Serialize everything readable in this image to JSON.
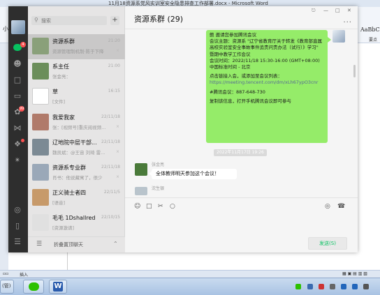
{
  "word": {
    "title": "11月18资源系党风实训室安全隐患排查工作部署.docx - Microsoft Word",
    "styles_preview": "AaBbCc",
    "styles_caption": "要点",
    "ribbon_fragment": "小",
    "status_insert": "插入",
    "taskbar_label": "(管)"
  },
  "wechat": {
    "sidebar": {
      "badges": {
        "chats": "4",
        "moments": "99"
      }
    },
    "search": {
      "placeholder": "搜索"
    },
    "add_label": "+",
    "conversations": [
      {
        "name": "资源系群",
        "time": "21:20",
        "preview": "资源管理制机制·陈于下降",
        "selected": true,
        "muted": true,
        "avatar_color": "#8aa07a"
      },
      {
        "name": "系主任",
        "time": "21:00",
        "preview": "张金亮：",
        "selected": false,
        "muted": false,
        "avatar_color": "#6b8e5a"
      },
      {
        "name": "草",
        "time": "16:15",
        "preview": "[文件]",
        "selected": false,
        "muted": false,
        "avatar_color": "#ffffff"
      },
      {
        "name": "我爱我家",
        "time": "22/11/18",
        "preview": "张：[视频号]重庆阅视频...",
        "selected": false,
        "muted": true,
        "avatar_color": "#b07a6a"
      },
      {
        "name": "辽地院中层干部...",
        "time": "22/11/18",
        "preview": "魏凯斌：@王宙 刘琦 雷...",
        "selected": false,
        "muted": true,
        "avatar_color": "#7c8a94"
      },
      {
        "name": "资源系专业群",
        "time": "22/11/18",
        "preview": "肖书：他说藏寓了，很少",
        "selected": false,
        "muted": true,
        "avatar_color": "#9aa8b8"
      },
      {
        "name": "正义骑士者四",
        "time": "22/11/5",
        "preview": "[语音]",
        "selected": false,
        "muted": false,
        "avatar_color": "#c79a6a"
      },
      {
        "name": "毛毛 1Dshallred",
        "time": "22/10/15",
        "preview": "[资源激请]",
        "selected": false,
        "muted": false,
        "avatar_color": "#e0e0e0"
      }
    ],
    "folded_label": "折叠置顶聊天",
    "chat": {
      "title": "资源系群 (29)",
      "bubble_lines": [
        "鲍 邀请您参加腾讯会议",
        "会议主题：资源系 \"辽宁省教育厅关于转发《教育部直属高校实验室安全事故事件追责问责办法（试行）》学习\" 暨期中教学工作会议",
        "会议时间：2022/11/18 15:30-16:00 (GMT+08:00) 中国标准时间 - 北京",
        "",
        "点击链接入会，或添加至会议列表：",
        "https://meeting.tencent.com/dm/xLh67ypO3cnr",
        "",
        "#腾讯会议：887-648-730",
        "",
        "复制该信息，打开手机腾讯会议即可参与"
      ],
      "time_divider": "2022年11月17日 19:26",
      "messages": [
        {
          "sender": "张金亮",
          "text": "全体教师明天参加这个会议！",
          "avatar_color": "#4a7a3a"
        },
        {
          "sender": "沈生银",
          "text": "",
          "avatar_color": "#b9c4cc"
        }
      ],
      "send_label": "发送(S)"
    }
  }
}
